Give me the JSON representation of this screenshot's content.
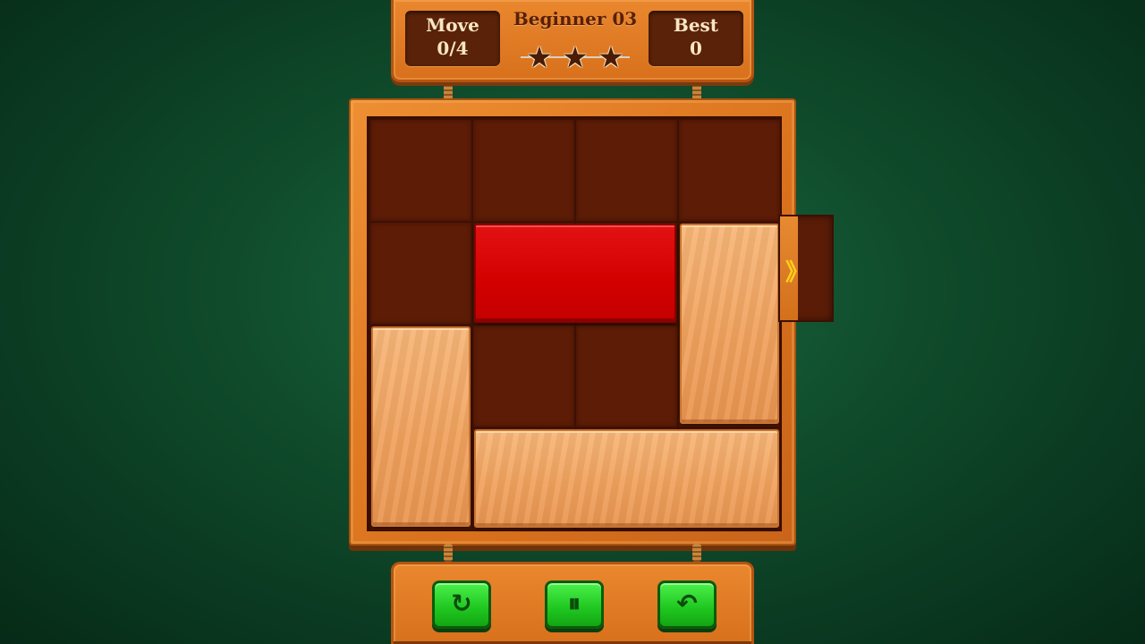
{
  "header": {
    "move_label": "Move",
    "move_value": "0/4",
    "level_title": "Beginner 03",
    "best_label": "Best",
    "best_value": "0",
    "stars": [
      "★",
      "★",
      "★"
    ]
  },
  "board": {
    "grid_size": 4,
    "exit_arrow": "》",
    "colors": {
      "cell": "#5d1c06",
      "wood_block": "#f0a25e",
      "target_block": "#d30000",
      "background": "#0f4a2b"
    }
  },
  "controls": {
    "restart_icon": "↻",
    "pause_icon": "⏸",
    "undo_icon": "↶"
  }
}
